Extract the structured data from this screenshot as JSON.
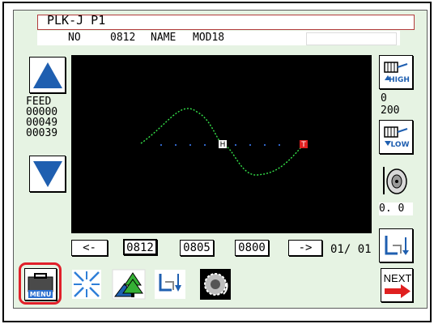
{
  "header": {
    "title": "PLK-J P1"
  },
  "info": {
    "no_label": "NO",
    "no_value": "0812",
    "name_label": "NAME",
    "name_value": "MOD18"
  },
  "feed": {
    "label": "FEED",
    "values": [
      "00000",
      "00049",
      "00039"
    ]
  },
  "speed": {
    "high_value": "0",
    "low_value": "200",
    "high_icon_label": "HIGH",
    "low_icon_label": "LOW"
  },
  "tension": {
    "value": "0. 0"
  },
  "pattern": {
    "start_marker": "H",
    "end_marker": "T"
  },
  "nav": {
    "prev_label": "<-",
    "next_label": "->",
    "patterns": [
      "0812",
      "0805",
      "0800"
    ],
    "page_indicator": "01/ 01"
  },
  "toolbar": {
    "menu_label": "MENU",
    "next_label": "NEXT"
  },
  "colors": {
    "panel": "#e6f3e3",
    "stitch": "#35e24a",
    "highlight": "#e0202a",
    "arrow_blue": "#1f5fb0",
    "marker_end": "#e02020"
  }
}
